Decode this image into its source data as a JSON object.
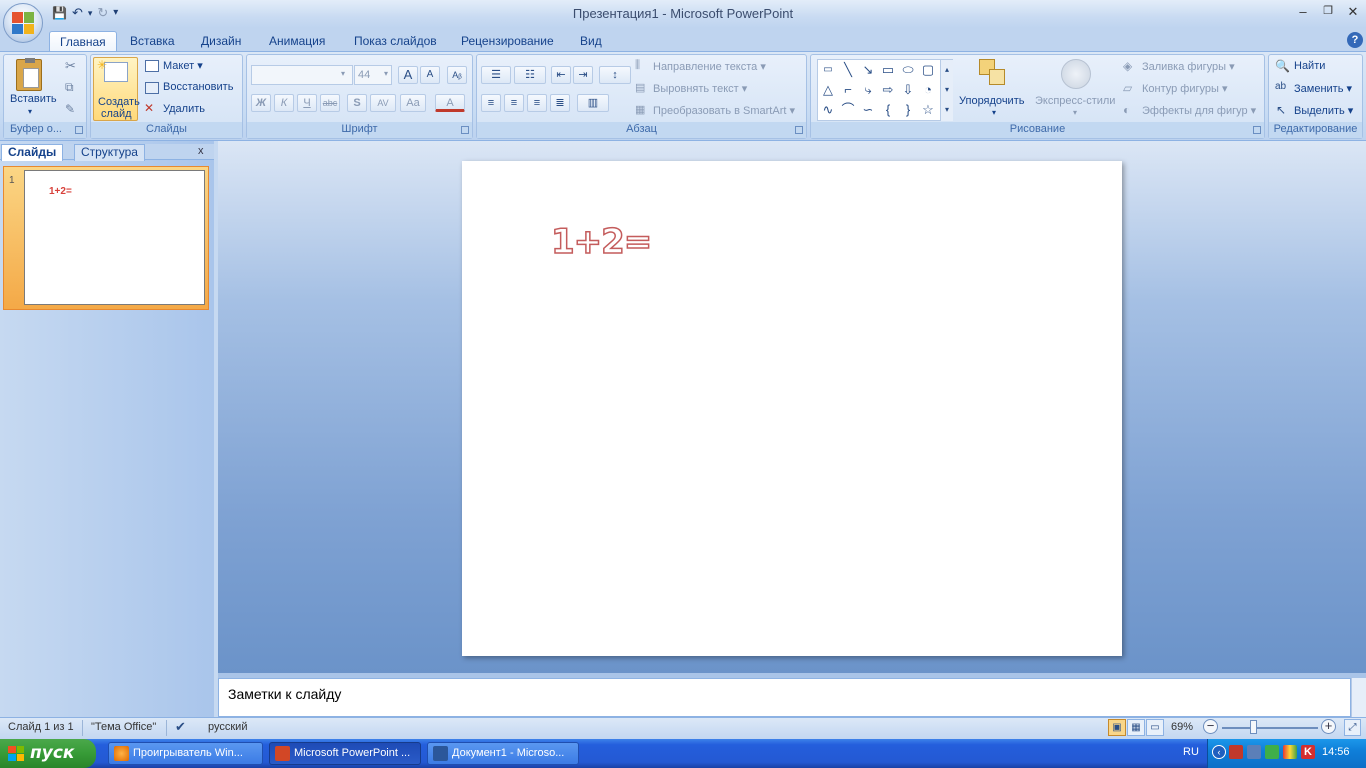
{
  "window": {
    "title": "Презентация1 - Microsoft PowerPoint",
    "controls": {
      "minimize": "–",
      "restore": "❐",
      "close": "✕"
    }
  },
  "qat": {
    "save": "💾",
    "undo": "↶",
    "redo": "↻",
    "more": "▾"
  },
  "tabs": [
    {
      "label": "Главная",
      "active": true
    },
    {
      "label": "Вставка"
    },
    {
      "label": "Дизайн"
    },
    {
      "label": "Анимация"
    },
    {
      "label": "Показ слайдов"
    },
    {
      "label": "Рецензирование"
    },
    {
      "label": "Вид"
    }
  ],
  "help": "?",
  "ribbon": {
    "clipboard": {
      "label": "Буфер о...",
      "paste": "Вставить"
    },
    "slides": {
      "label": "Слайды",
      "new_slide": "Создать слайд",
      "new_slide_1": "Создать",
      "new_slide_2": "слайд",
      "layout": "Макет",
      "reset": "Восстановить",
      "delete": "Удалить"
    },
    "font": {
      "label": "Шрифт",
      "font_name": "",
      "font_size": "44",
      "bold": "Ж",
      "italic": "К",
      "underline": "Ч",
      "strike": "abc",
      "shadow": "S",
      "spacing": "AV",
      "case": "Aa",
      "color": "A",
      "grow": "A",
      "shrink": "A"
    },
    "paragraph": {
      "label": "Абзац",
      "text_direction": "Направление текста",
      "align_text": "Выровнять текст",
      "smartart": "Преобразовать в SmartArt"
    },
    "drawing": {
      "label": "Рисование",
      "arrange": "Упорядочить",
      "quick_styles": "Экспресс-стили",
      "fill": "Заливка фигуры",
      "outline": "Контур фигуры",
      "effects": "Эффекты для фигур"
    },
    "editing": {
      "label": "Редактирование",
      "find": "Найти",
      "replace": "Заменить",
      "select": "Выделить"
    }
  },
  "panel": {
    "tab_slides": "Слайды",
    "tab_outline": "Структура",
    "close": "x",
    "thumb_number": "1",
    "thumb_text": "1+2="
  },
  "slide": {
    "text": "1+2="
  },
  "notes": {
    "placeholder": "Заметки к слайду"
  },
  "status": {
    "slide_info": "Слайд 1 из 1",
    "theme": "\"Тема Office\"",
    "language": "русский",
    "zoom": "69%",
    "zoom_level": 0.69
  },
  "taskbar": {
    "start": "пуск",
    "tasks": [
      {
        "label": "Проигрыватель Win..."
      },
      {
        "label": "Microsoft PowerPoint ...",
        "active": true
      },
      {
        "label": "Документ1 - Microso..."
      }
    ],
    "lang": "RU",
    "clock": "14:56"
  },
  "colors": {
    "accent": "#15428b",
    "ribbon": "#c7dbf3",
    "slide_text_outline": "#c45c5c",
    "taskbar": "#245edc",
    "start": "#379b37"
  }
}
